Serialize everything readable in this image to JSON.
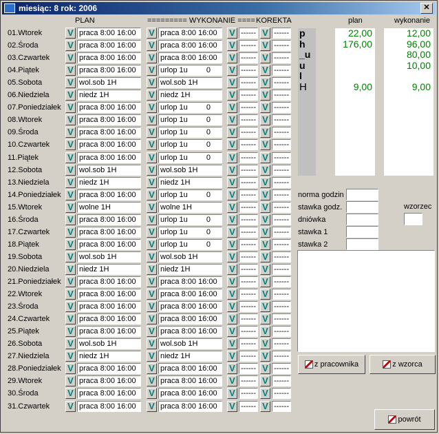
{
  "window": {
    "title": "miesiąc:  8 rok: 2006",
    "close": "✕"
  },
  "headers": {
    "plan": "PLAN",
    "wykonanie": "========= WYKONANIE ====",
    "korekta": "KOREKTA",
    "sum_plan": "plan",
    "sum_wykonanie": "wykonanie"
  },
  "v_glyph": "V",
  "rows": [
    {
      "day": "01.Wtorek",
      "plan": "praca  8:00 16:00",
      "wyk": "praca  8:00 16:00",
      "wyk_num": "",
      "k1": "------",
      "k2": "------"
    },
    {
      "day": "02.Środa",
      "plan": "praca  8:00 16:00",
      "wyk": "praca  8:00 16:00",
      "wyk_num": "",
      "k1": "------",
      "k2": "------"
    },
    {
      "day": "03.Czwartek",
      "plan": "praca  8:00 16:00",
      "wyk": "praca  8:00 16:00",
      "wyk_num": "",
      "k1": "------",
      "k2": "------"
    },
    {
      "day": "04.Piątek",
      "plan": "praca  8:00 16:00",
      "wyk": "urlop  1u",
      "wyk_num": "0",
      "k1": "------",
      "k2": "------"
    },
    {
      "day": "05.Sobota",
      "plan": "wol.sob  1H",
      "wyk": "wol.sob  1H",
      "wyk_num": "",
      "k1": "------",
      "k2": "------"
    },
    {
      "day": "06.Niedziela",
      "plan": "niedz  1H",
      "wyk": "niedz  1H",
      "wyk_num": "",
      "k1": "------",
      "k2": "------"
    },
    {
      "day": "07.Poniedziałek",
      "plan": "praca  8:00 16:00",
      "wyk": "urlop  1u",
      "wyk_num": "0",
      "k1": "------",
      "k2": "------"
    },
    {
      "day": "08.Wtorek",
      "plan": "praca  8:00 16:00",
      "wyk": "urlop  1u",
      "wyk_num": "0",
      "k1": "------",
      "k2": "------"
    },
    {
      "day": "09.Środa",
      "plan": "praca  8:00 16:00",
      "wyk": "urlop  1u",
      "wyk_num": "0",
      "k1": "------",
      "k2": "------"
    },
    {
      "day": "10.Czwartek",
      "plan": "praca  8:00 16:00",
      "wyk": "urlop  1u",
      "wyk_num": "0",
      "k1": "------",
      "k2": "------"
    },
    {
      "day": "11.Piątek",
      "plan": "praca  8:00 16:00",
      "wyk": "urlop  1u",
      "wyk_num": "0",
      "k1": "------",
      "k2": "------"
    },
    {
      "day": "12.Sobota",
      "plan": "wol.sob  1H",
      "wyk": "wol.sob  1H",
      "wyk_num": "",
      "k1": "------",
      "k2": "------"
    },
    {
      "day": "13.Niedziela",
      "plan": "niedz  1H",
      "wyk": "niedz  1H",
      "wyk_num": "",
      "k1": "------",
      "k2": "------"
    },
    {
      "day": "14.Poniedziałek",
      "plan": "praca  8:00 16:00",
      "wyk": "urlop  1u",
      "wyk_num": "0",
      "k1": "------",
      "k2": "------"
    },
    {
      "day": "15.Wtorek",
      "plan": "wolne  1H",
      "wyk": "wolne  1H",
      "wyk_num": "",
      "k1": "------",
      "k2": "------"
    },
    {
      "day": "16.Środa",
      "plan": "praca  8:00 16:00",
      "wyk": "urlop  1u",
      "wyk_num": "0",
      "k1": "------",
      "k2": "------"
    },
    {
      "day": "17.Czwartek",
      "plan": "praca  8:00 16:00",
      "wyk": "urlop  1u",
      "wyk_num": "0",
      "k1": "------",
      "k2": "------"
    },
    {
      "day": "18.Piątek",
      "plan": "praca  8:00 16:00",
      "wyk": "urlop  1u",
      "wyk_num": "0",
      "k1": "------",
      "k2": "------"
    },
    {
      "day": "19.Sobota",
      "plan": "wol.sob  1H",
      "wyk": "wol.sob  1H",
      "wyk_num": "",
      "k1": "------",
      "k2": "------"
    },
    {
      "day": "20.Niedziela",
      "plan": "niedz  1H",
      "wyk": "niedz  1H",
      "wyk_num": "",
      "k1": "------",
      "k2": "------"
    },
    {
      "day": "21.Poniedziałek",
      "plan": "praca  8:00 16:00",
      "wyk": "praca  8:00 16:00",
      "wyk_num": "",
      "k1": "------",
      "k2": "------"
    },
    {
      "day": "22.Wtorek",
      "plan": "praca  8:00 16:00",
      "wyk": "praca  8:00 16:00",
      "wyk_num": "",
      "k1": "------",
      "k2": "------"
    },
    {
      "day": "23.Środa",
      "plan": "praca  8:00 16:00",
      "wyk": "praca  8:00 16:00",
      "wyk_num": "",
      "k1": "------",
      "k2": "------"
    },
    {
      "day": "24.Czwartek",
      "plan": "praca  8:00 16:00",
      "wyk": "praca  8:00 16:00",
      "wyk_num": "",
      "k1": "------",
      "k2": "------"
    },
    {
      "day": "25.Piątek",
      "plan": "praca  8:00 16:00",
      "wyk": "praca  8:00 16:00",
      "wyk_num": "",
      "k1": "------",
      "k2": "------"
    },
    {
      "day": "26.Sobota",
      "plan": "wol.sob  1H",
      "wyk": "wol.sob  1H",
      "wyk_num": "",
      "k1": "------",
      "k2": "------"
    },
    {
      "day": "27.Niedziela",
      "plan": "niedz  1H",
      "wyk": "niedz  1H",
      "wyk_num": "",
      "k1": "------",
      "k2": "------"
    },
    {
      "day": "28.Poniedziałek",
      "plan": "praca  8:00 16:00",
      "wyk": "praca  8:00 16:00",
      "wyk_num": "",
      "k1": "------",
      "k2": "------"
    },
    {
      "day": "29.Wtorek",
      "plan": "praca  8:00 16:00",
      "wyk": "praca  8:00 16:00",
      "wyk_num": "",
      "k1": "------",
      "k2": "------"
    },
    {
      "day": "30.Środa",
      "plan": "praca  8:00 16:00",
      "wyk": "praca  8:00 16:00",
      "wyk_num": "",
      "k1": "------",
      "k2": "------"
    },
    {
      "day": "31.Czwartek",
      "plan": "praca  8:00 16:00",
      "wyk": "praca  8:00 16:00",
      "wyk_num": "",
      "k1": "------",
      "k2": "------"
    }
  ],
  "summary": {
    "labels": [
      "p",
      "h",
      "_u",
      "u",
      "l",
      "H"
    ],
    "plan": [
      "22,00",
      "176,00",
      "",
      "",
      "",
      "9,00"
    ],
    "wykonanie": [
      "12,00",
      "96,00",
      "80,00",
      "10,00",
      "",
      "9,00"
    ]
  },
  "fields": {
    "norma_godzin": "norma godzin",
    "stawka_godz": "stawka godz.",
    "dniowka": "dniówka",
    "stawka_1": "stawka 1",
    "stawka_2": "stawka 2",
    "wzorzec": "wzorzec"
  },
  "buttons": {
    "z_pracownika": "z pracownika",
    "z_wzorca": "z wzorca",
    "powrot": "powrót"
  }
}
